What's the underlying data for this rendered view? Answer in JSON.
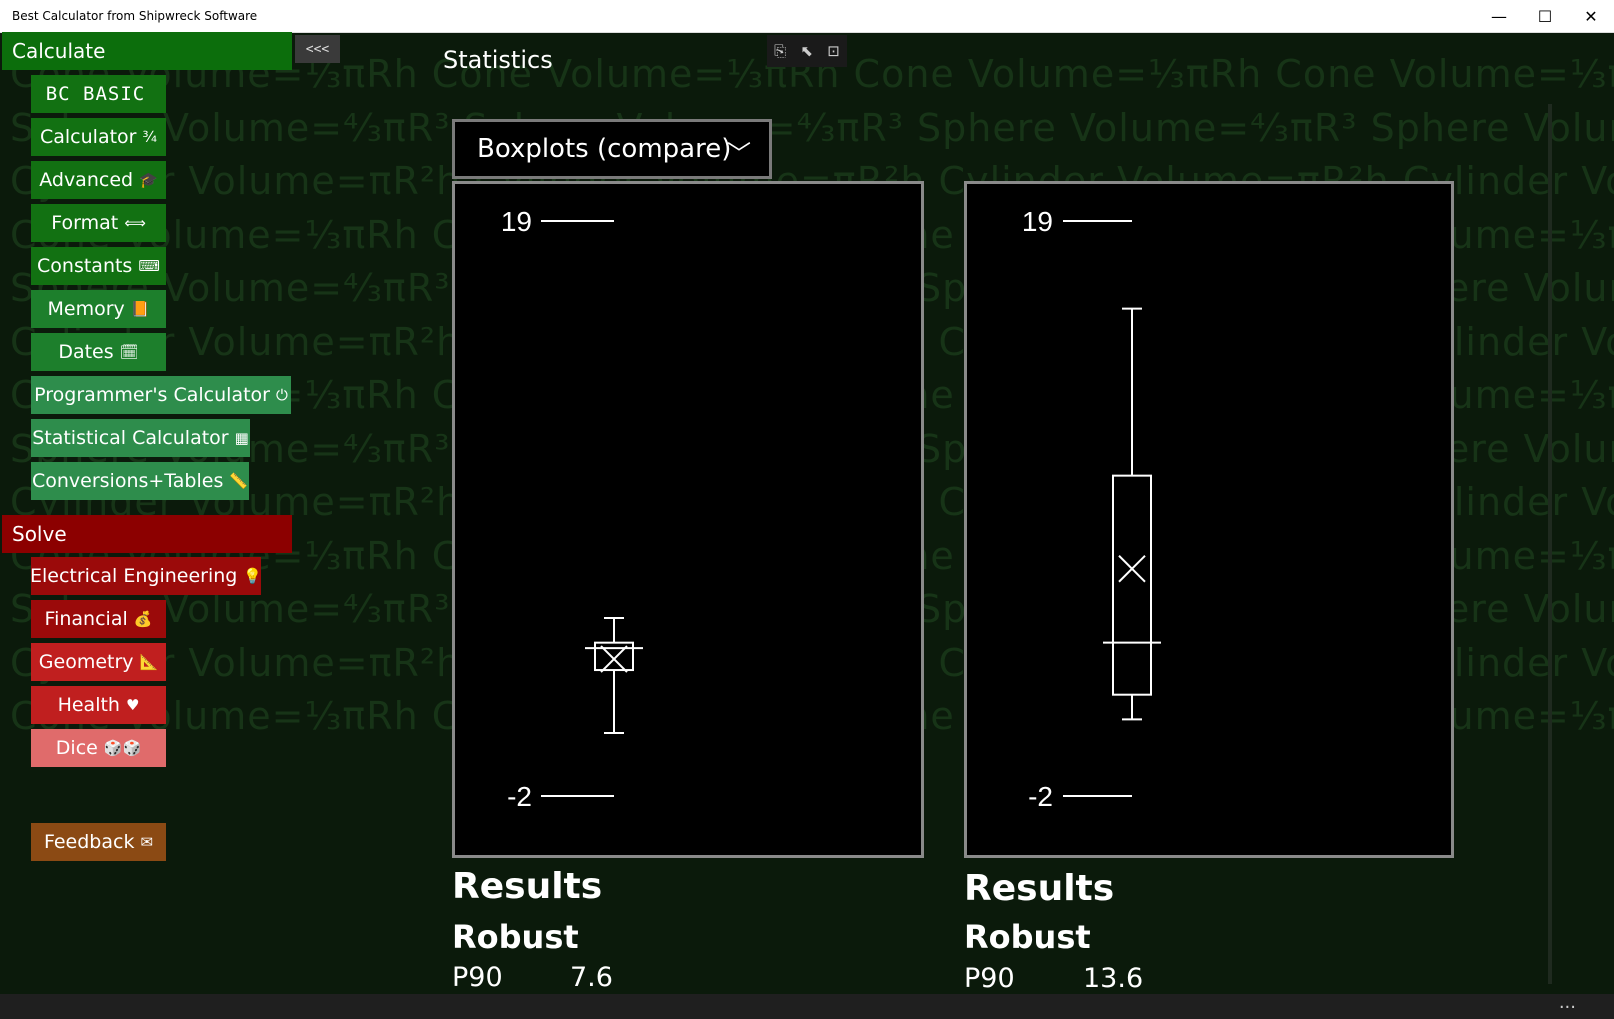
{
  "window": {
    "title": "Best Calculator from Shipwreck Software",
    "minimize": "—",
    "maximize": "☐",
    "close": "✕"
  },
  "watermark": {
    "rows": [
      "Cone Volume=⅓πRh   Cone Volume=⅓πRh   Cone Volume=⅓πRh   Cone Volume=⅓πRh",
      "Sphere Volume=⁴⁄₃πR³   Sphere Volume=⁴⁄₃πR³   Sphere Volume=⁴⁄₃πR³   Sphere Volume=⁴⁄₃",
      "Cylinder Volume=πR²h   Cylinder Volume=πR²h   Cylinder Volume=πR²h   Cylinder Volume=π",
      "Cone Volume=⅓πRh   Cone Volume=⅓πRh   Cone Volume=⅓πRh   Cone Volume=⅓πRh",
      "Sphere Volume=⁴⁄₃πR³   Sphere Volume=⁴⁄₃πR³   Sphere Volume=⁴⁄₃πR³   Sphere Volume=⁴⁄₃",
      "Cylinder Volume=πR²h   Cylinder Volume=πR²h   Cylinder Volume=πR²h   Cylinder Volume=π",
      "Cone Volume=⅓πRh   Cone Volume=⅓πRh   Cone Volume=⅓πRh   Cone Volume=⅓πRh",
      "Sphere Volume=⁴⁄₃πR³   Sphere Volume=⁴⁄₃πR³   Sphere Volume=⁴⁄₃πR³   Sphere Volume=⁴⁄₃",
      "Cylinder Volume=πR²h   Cylinder Volume=πR²h   Cylinder Volume=πR²h   Cylinder Volume=π",
      "Cone Volume=⅓πRh   Cone Volume=⅓πRh   Cone Volume=⅓πRh   Cone Volume=⅓πRh",
      "Sphere Volume=⁴⁄₃πR³   Sphere Volume=⁴⁄₃πR³   Sphere Volume=⁴⁄₃πR³   Sphere Volume=⁴⁄₃",
      "Cylinder Volume=πR²h   Cylinder Volume=πR²h   Cylinder Volume=πR²h   Cylinder Volume=π",
      "Cone Volume=⅓πRh   Cone Volume=⅓πRh   Cone Volume=⅓πRh   Cone Volume=⅓πRh"
    ]
  },
  "sidebar": {
    "collapse_label": "<<<",
    "calculate_header": "Calculate",
    "calculate_items": [
      {
        "label": "BC BASIC",
        "icon": ""
      },
      {
        "label": "Calculator",
        "icon": "¾"
      },
      {
        "label": "Advanced",
        "icon": "🎓"
      },
      {
        "label": "Format",
        "icon": "⟺"
      },
      {
        "label": "Constants",
        "icon": "⌨"
      },
      {
        "label": "Memory",
        "icon": "📙"
      },
      {
        "label": "Dates",
        "icon": "🗓"
      },
      {
        "label": "Programmer's Calculator",
        "icon": "⏻"
      },
      {
        "label": "Statistical Calculator",
        "icon": "▦"
      },
      {
        "label": "Conversions+Tables",
        "icon": "📏"
      }
    ],
    "solve_header": "Solve",
    "solve_items": [
      {
        "label": "Electrical Engineering",
        "icon": "💡"
      },
      {
        "label": "Financial",
        "icon": "💰"
      },
      {
        "label": "Geometry",
        "icon": "📐"
      },
      {
        "label": "Health",
        "icon": "♥"
      },
      {
        "label": "Dice",
        "icon": "🎲🎲"
      }
    ],
    "feedback": {
      "label": "Feedback",
      "icon": "✉"
    }
  },
  "main": {
    "title": "Statistics",
    "toolbar": [
      "copy-icon",
      "pointer-icon",
      "fit-icon"
    ],
    "dropdown": {
      "selected": "Boxplots (compare)",
      "chevron": "﹀"
    }
  },
  "chart_data": [
    {
      "type": "boxplot",
      "ylim": [
        -2,
        19
      ],
      "tick_labels": [
        "19",
        "-2"
      ],
      "box": {
        "whisker_low": 0.3,
        "q1": 2.6,
        "median": 3.4,
        "q3": 3.6,
        "whisker_high": 4.5,
        "mean": 3.0
      }
    },
    {
      "type": "boxplot",
      "ylim": [
        -2,
        19
      ],
      "tick_labels": [
        "19",
        "-2"
      ],
      "box": {
        "whisker_low": 0.8,
        "q1": 1.7,
        "median": 3.6,
        "q3": 9.7,
        "whisker_high": 15.8,
        "mean": 6.3
      }
    }
  ],
  "results": [
    {
      "heading": "Results",
      "subheading": "Robust",
      "label": "P90",
      "value": "7.6"
    },
    {
      "heading": "Results",
      "subheading": "Robust",
      "label": "P90",
      "value": "13.6"
    }
  ],
  "bottombar": {
    "more": "..."
  }
}
